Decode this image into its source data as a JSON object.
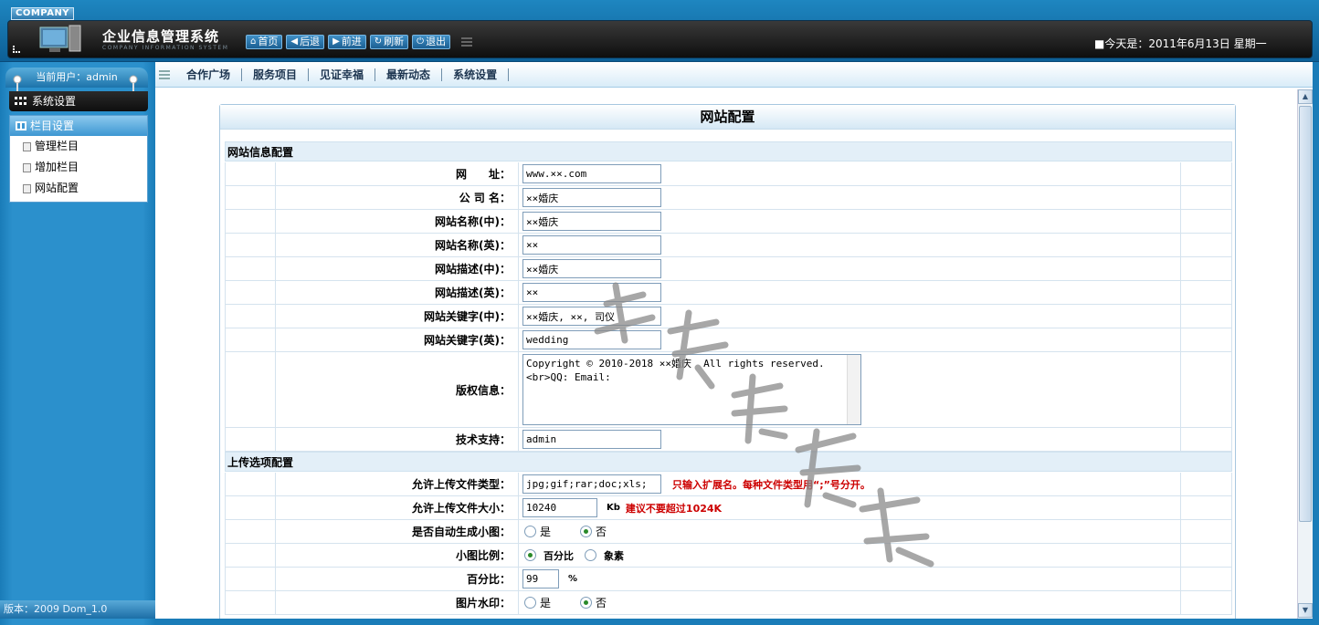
{
  "header": {
    "badge": "COMPANY",
    "title": "企业信息管理系统",
    "subtitle": "COMPANY INFORMATION SYSTEM",
    "nav": [
      {
        "label": "首页",
        "icon": "home-icon"
      },
      {
        "label": "后退",
        "icon": "arrow-left-icon"
      },
      {
        "label": "前进",
        "icon": "arrow-right-icon"
      },
      {
        "label": "刷新",
        "icon": "refresh-icon"
      },
      {
        "label": "退出",
        "icon": "power-icon"
      }
    ],
    "date": "■今天是：2011年6月13日  星期一"
  },
  "sidebar": {
    "user": "当前用户：admin",
    "section": "系统设置",
    "group": "栏目设置",
    "items": [
      "管理栏目",
      "增加栏目",
      "网站配置"
    ],
    "version": "版本：2009 Dom_1.0"
  },
  "menubar": {
    "tabs": [
      "合作广场",
      "服务项目",
      "见证幸福",
      "最新动态",
      "系统设置"
    ]
  },
  "panel": {
    "title": "网站配置",
    "section1": "网站信息配置",
    "section2": "上传选项配置",
    "fields": {
      "url": {
        "label": "网　　址：",
        "value": "www.××.com"
      },
      "company": {
        "label": "公 司 名：",
        "value": "××婚庆"
      },
      "name_cn": {
        "label": "网站名称(中)：",
        "value": "××婚庆"
      },
      "name_en": {
        "label": "网站名称(英)：",
        "value": "××"
      },
      "desc_cn": {
        "label": "网站描述(中)：",
        "value": "××婚庆"
      },
      "desc_en": {
        "label": "网站描述(英)：",
        "value": "××"
      },
      "kw_cn": {
        "label": "网站关键字(中)：",
        "value": "××婚庆, ××, 司仪"
      },
      "kw_en": {
        "label": "网站关键字(英)：",
        "value": "wedding"
      },
      "copyright": {
        "label": "版权信息：",
        "value": "Copyright © 2010-2018 ××婚庆  All rights reserved.<br>QQ: Email:"
      },
      "support": {
        "label": "技术支持：",
        "value": "admin"
      },
      "types": {
        "label": "允许上传文件类型：",
        "value": "jpg;gif;rar;doc;xls;",
        "hint": "只输入扩展名。每种文件类型用“;”号分开。"
      },
      "size": {
        "label": "允许上传文件大小：",
        "value": "10240",
        "unit": "Kb",
        "hint": "建议不要超过1024K"
      },
      "thumb": {
        "label": "是否自动生成小图：",
        "opt_yes": "是",
        "opt_no": "否",
        "selected": "否"
      },
      "ratio": {
        "label": "小图比例：",
        "opt_pct": "百分比",
        "opt_px": "象素",
        "selected": "百分比"
      },
      "percent": {
        "label": "百分比：",
        "value": "99",
        "unit": "%"
      },
      "watermark": {
        "label": "图片水印：",
        "opt_yes": "是",
        "opt_no": "否",
        "selected": "否"
      }
    }
  },
  "colors": {
    "frame": "#1a7cb8",
    "hint": "#cc0000",
    "section_bg": "#e3eff8"
  }
}
